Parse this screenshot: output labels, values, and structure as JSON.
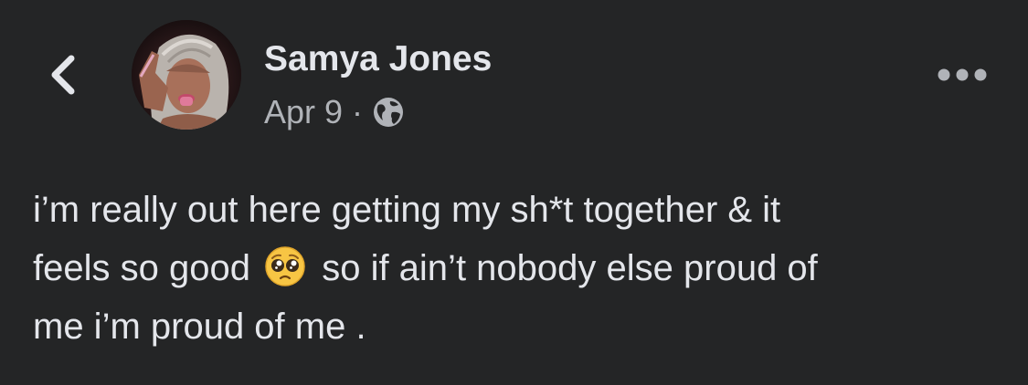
{
  "header": {
    "back_icon": "chevron-left-icon",
    "author_name": "Samya Jones",
    "date": "Apr 9",
    "separator": "·",
    "privacy_icon": "globe-icon",
    "more_icon": "more-horizontal-icon"
  },
  "post": {
    "line1": "i’m really out here getting my sh*t together & it",
    "line2_before": "feels so good",
    "emoji": "pleading-face-emoji",
    "line2_after": "so if ain’t nobody else proud of",
    "line3": "me i’m proud of me ."
  },
  "colors": {
    "background": "#242526",
    "primary_text": "#e4e6eb",
    "secondary_text": "#b0b3b8"
  }
}
